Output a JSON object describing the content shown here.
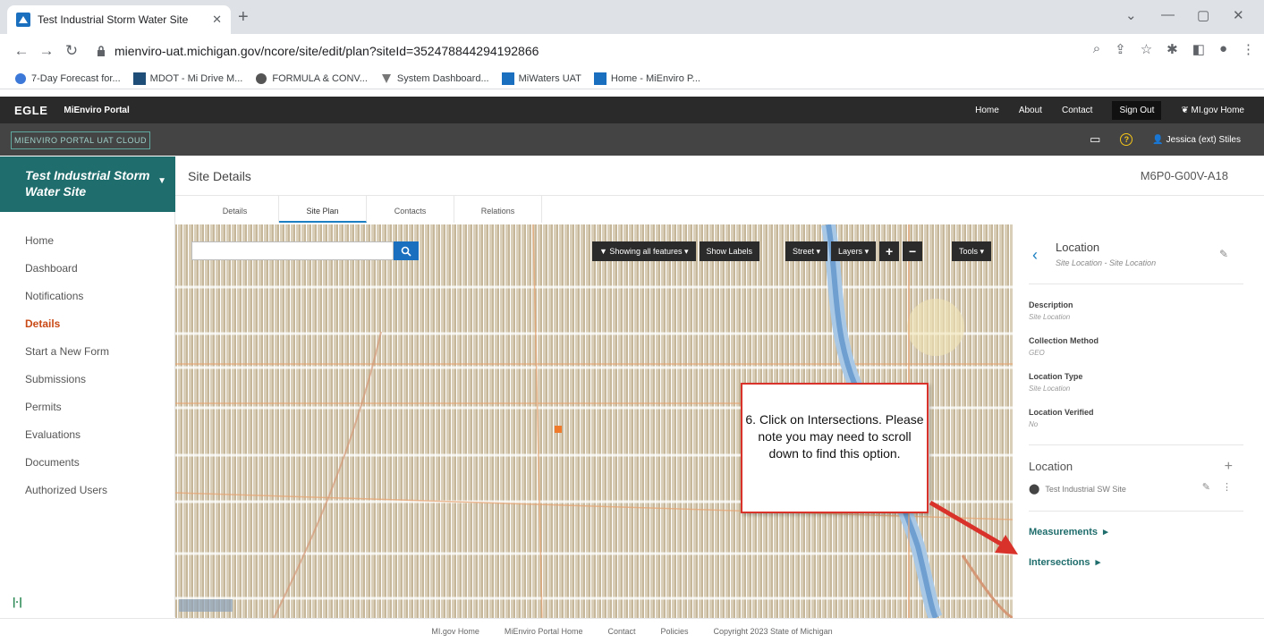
{
  "browser": {
    "tab_title": "Test Industrial Storm Water Site",
    "url": "mienviro-uat.michigan.gov/ncore/site/edit/plan?siteId=352478844294192866",
    "bookmarks": [
      "7-Day Forecast for...",
      "MDOT - Mi Drive M...",
      "FORMULA & CONV...",
      "System Dashboard...",
      "MiWaters UAT",
      "Home - MiEnviro P..."
    ]
  },
  "app": {
    "logo": "EGLE",
    "portal_name": "MiEnviro Portal",
    "nav": [
      "Home",
      "About",
      "Contact",
      "Sign Out"
    ],
    "migov": "MI.gov Home",
    "env_badge": "MIENVIRO PORTAL UAT CLOUD",
    "user": "Jessica (ext) Stiles"
  },
  "sidebar": {
    "site_name": "Test Industrial Storm Water Site",
    "items": [
      {
        "label": "Home"
      },
      {
        "label": "Dashboard"
      },
      {
        "label": "Notifications"
      },
      {
        "label": "Details",
        "active": true
      },
      {
        "label": "Start a New Form"
      },
      {
        "label": "Submissions"
      },
      {
        "label": "Permits"
      },
      {
        "label": "Evaluations"
      },
      {
        "label": "Documents"
      },
      {
        "label": "Authorized Users"
      }
    ]
  },
  "main": {
    "title": "Site Details",
    "site_id": "M6P0-G00V-A18",
    "tabs": [
      "Details",
      "Site Plan",
      "Contacts",
      "Relations"
    ],
    "selected_tab": "Site Plan"
  },
  "map": {
    "tools": {
      "showing": "Showing all features",
      "show_labels": "Show Labels",
      "street": "Street",
      "layers": "Layers",
      "zoom_in": "+",
      "zoom_out": "−",
      "tools": "Tools"
    }
  },
  "callout": {
    "text": "6. Click on Intersections. Please note you may need to scroll down to find this option."
  },
  "panel": {
    "title": "Location",
    "subtitle": "Site Location - Site Location",
    "fields": [
      {
        "label": "Description",
        "value": "Site Location"
      },
      {
        "label": "Collection Method",
        "value": "GEO"
      },
      {
        "label": "Location Type",
        "value": "Site Location"
      },
      {
        "label": "Location Verified",
        "value": "No"
      }
    ],
    "location_heading": "Location",
    "location_item": "Test Industrial SW Site",
    "measurements": "Measurements",
    "intersections": "Intersections"
  },
  "footer": {
    "links": [
      "MI.gov Home",
      "MiEnviro Portal Home",
      "Contact",
      "Policies",
      "Copyright 2023 State of Michigan"
    ]
  },
  "colors": {
    "teal": "#1f6d6c",
    "active_orange": "#c94a16",
    "callout_red": "#d9322b",
    "link_blue": "#1b7fc1"
  }
}
